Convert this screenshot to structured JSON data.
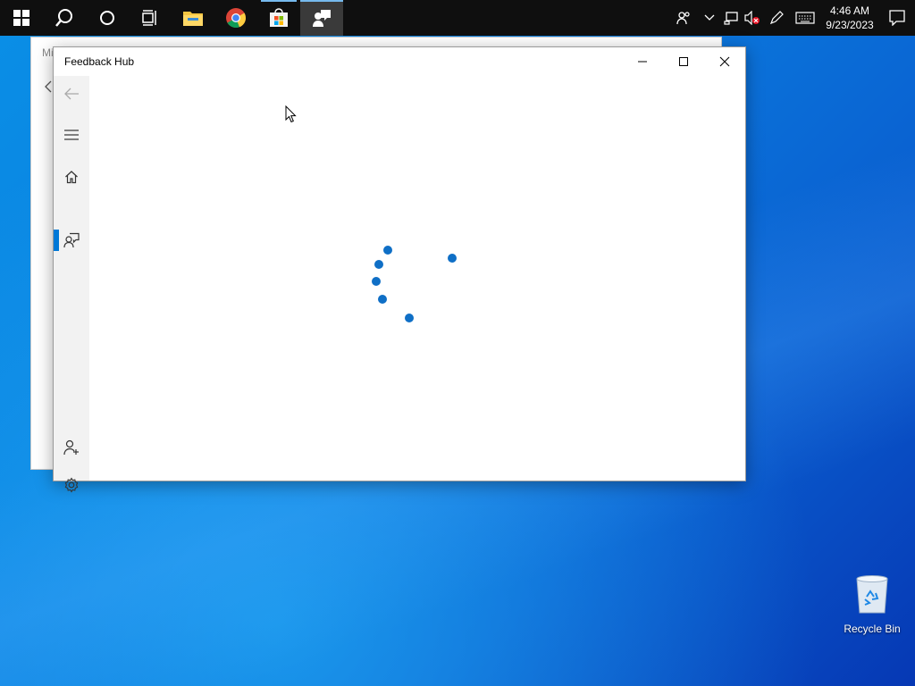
{
  "taskbar": {
    "apps": [
      {
        "name": "start-icon"
      },
      {
        "name": "search-icon"
      },
      {
        "name": "cortana-icon"
      },
      {
        "name": "task-view-icon"
      },
      {
        "name": "file-explorer-icon"
      },
      {
        "name": "chrome-icon"
      },
      {
        "name": "store-icon"
      },
      {
        "name": "feedback-hub-icon"
      }
    ],
    "clock_time": "4:46 AM",
    "clock_date": "9/23/2023"
  },
  "background_window": {
    "title": "Mi"
  },
  "window": {
    "title": "Feedback Hub"
  },
  "sidebar": {
    "items": [
      {
        "name": "back-arrow-icon"
      },
      {
        "name": "menu-icon"
      },
      {
        "name": "home-icon"
      },
      {
        "name": "feedback-icon"
      },
      {
        "name": "add-user-icon"
      },
      {
        "name": "settings-icon"
      }
    ]
  },
  "desktop": {
    "recycle_bin_label": "Recycle Bin"
  },
  "colors": {
    "accent": "#0078d7",
    "spinner": "#0f6fc6",
    "taskbar": "#0f0f0f"
  }
}
